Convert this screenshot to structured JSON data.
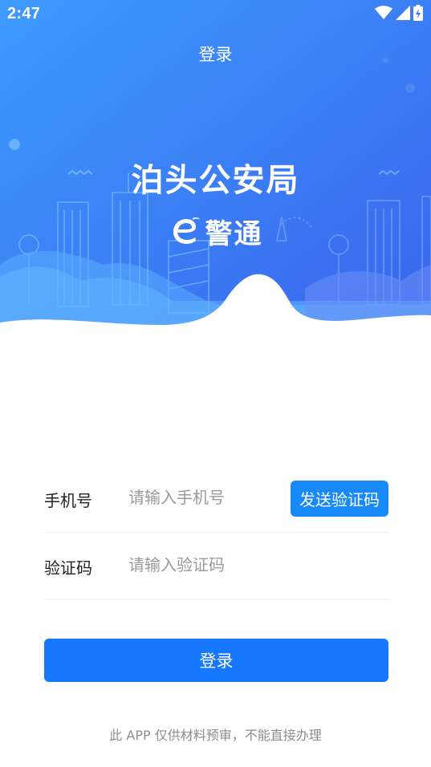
{
  "status_bar": {
    "time": "2:47",
    "icons": [
      "wifi-icon",
      "cellular-signal-icon",
      "battery-charging-icon"
    ]
  },
  "nav": {
    "title": "登录"
  },
  "hero": {
    "title": "泊头公安局",
    "brand_logo": "e-logo-icon",
    "brand_name": "警通",
    "colors": {
      "gradient_top_left": "#3d9bff",
      "gradient_bottom_right": "#3a63ec",
      "wave": "#ffffff"
    }
  },
  "form": {
    "phone": {
      "label": "手机号",
      "placeholder": "请输入手机号",
      "value": ""
    },
    "send_code_label": "发送验证码",
    "code": {
      "label": "验证码",
      "placeholder": "请输入验证码",
      "value": ""
    }
  },
  "login_button_label": "登录",
  "disclaimer": "此 APP 仅供材料预审，不能直接办理",
  "colors": {
    "primary": "#1677ff",
    "send_code_bg": "#1889fa",
    "divider": "#eeeeee",
    "placeholder": "#9a9a9a",
    "disclaimer_text": "#8c8c8c"
  }
}
